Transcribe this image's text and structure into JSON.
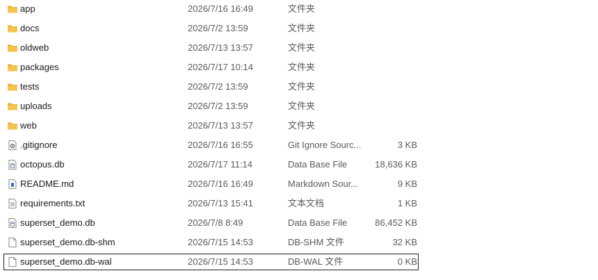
{
  "files": [
    {
      "name": "app",
      "date": "2026/7/16 16:49",
      "type": "文件夹",
      "size": "",
      "icon": "folder-icon"
    },
    {
      "name": "docs",
      "date": "2026/7/2 13:59",
      "type": "文件夹",
      "size": "",
      "icon": "folder-icon"
    },
    {
      "name": "oldweb",
      "date": "2026/7/13 13:57",
      "type": "文件夹",
      "size": "",
      "icon": "folder-icon"
    },
    {
      "name": "packages",
      "date": "2026/7/17 10:14",
      "type": "文件夹",
      "size": "",
      "icon": "folder-icon"
    },
    {
      "name": "tests",
      "date": "2026/7/2 13:59",
      "type": "文件夹",
      "size": "",
      "icon": "folder-icon"
    },
    {
      "name": "uploads",
      "date": "2026/7/2 13:59",
      "type": "文件夹",
      "size": "",
      "icon": "folder-icon"
    },
    {
      "name": "web",
      "date": "2026/7/13 13:57",
      "type": "文件夹",
      "size": "",
      "icon": "folder-icon"
    },
    {
      "name": ".gitignore",
      "date": "2026/7/16 16:55",
      "type": "Git Ignore Sourc...",
      "size": "3 KB",
      "icon": "gear-file-icon"
    },
    {
      "name": "octopus.db",
      "date": "2026/7/17 11:14",
      "type": "Data Base File",
      "size": "18,636 KB",
      "icon": "database-file-icon"
    },
    {
      "name": "README.md",
      "date": "2026/7/16 16:49",
      "type": "Markdown Sour...",
      "size": "9 KB",
      "icon": "markdown-file-icon"
    },
    {
      "name": "requirements.txt",
      "date": "2026/7/13 15:41",
      "type": "文本文档",
      "size": "1 KB",
      "icon": "text-file-icon"
    },
    {
      "name": "superset_demo.db",
      "date": "2026/7/8 8:49",
      "type": "Data Base File",
      "size": "86,452 KB",
      "icon": "database-file-icon"
    },
    {
      "name": "superset_demo.db-shm",
      "date": "2026/7/15 14:53",
      "type": "DB-SHM 文件",
      "size": "32 KB",
      "icon": "blank-file-icon"
    },
    {
      "name": "superset_demo.db-wal",
      "date": "2026/7/15 14:53",
      "type": "DB-WAL 文件",
      "size": "0 KB",
      "icon": "blank-file-icon"
    }
  ],
  "selected_index": 13,
  "colors": {
    "folder": "#f4c44e",
    "folder_tab": "#e0a82e",
    "file_border": "#8a8a8a",
    "db_accent": "#6b7d99",
    "md_accent": "#2f6fd1",
    "selection_border": "#1f1f1f"
  }
}
